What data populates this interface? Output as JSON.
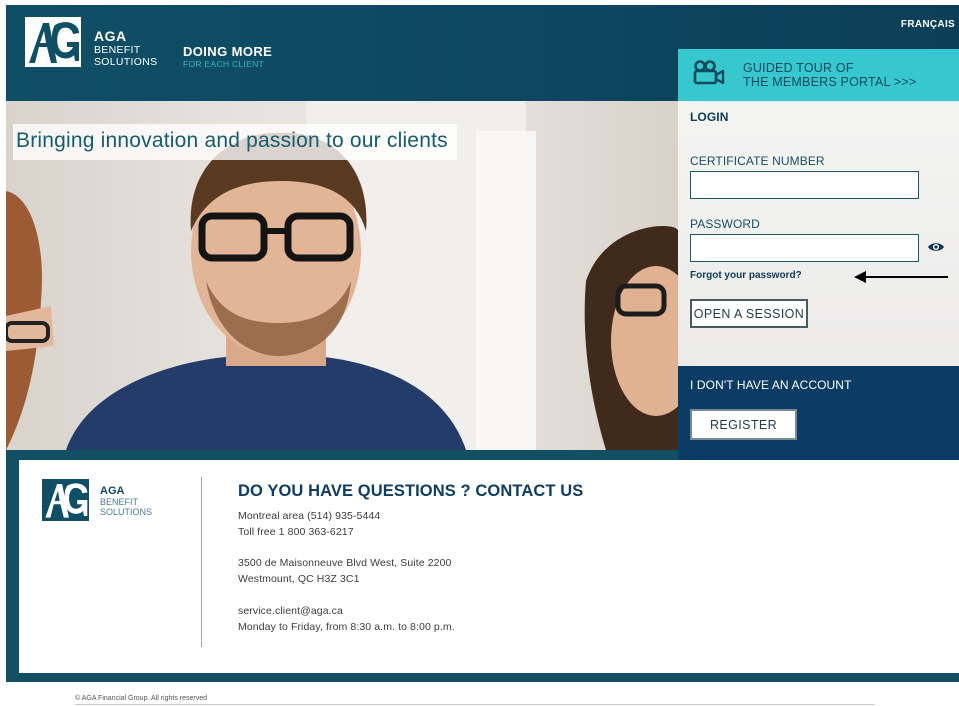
{
  "header": {
    "language_link": "FRANÇAIS",
    "brand": {
      "line1": "AGA",
      "line2": "BENEFIT",
      "line3": "SOLUTIONS"
    },
    "slogan": {
      "line1": "DOING MORE",
      "line2": "FOR EACH CLIENT"
    },
    "colors": {
      "header": "#0f4f66",
      "accent": "#3fb1c4"
    }
  },
  "tour": {
    "icon": "video-camera-icon",
    "line1": "GUIDED TOUR OF",
    "line2": "THE MEMBERS PORTAL >>>",
    "color": "#37c8cf"
  },
  "hero": {
    "caption": "Bringing innovation and passion to our clients"
  },
  "login": {
    "title": "LOGIN",
    "certificate_label": "CERTIFICATE NUMBER",
    "certificate_value": "",
    "password_label": "PASSWORD",
    "password_value": "",
    "show_password_icon": "eye-icon",
    "forgot_link": "Forgot your password?",
    "submit_label": "OPEN A SESSION"
  },
  "register": {
    "prompt": "I DON'T HAVE AN ACCOUNT",
    "button_label": "REGISTER",
    "color": "#0b3c66"
  },
  "contact": {
    "brand": {
      "line1": "AGA",
      "line2": "BENEFIT",
      "line3": "SOLUTIONS"
    },
    "title": "DO YOU HAVE QUESTIONS ? CONTACT US",
    "phone_local": "Montreal area (514) 935-5444",
    "phone_toll_free": "Toll free 1 800 363-6217",
    "address_line1": "3500 de Maisonneuve Blvd West, Suite 2200",
    "address_line2": "Westmount, QC H3Z 3C1",
    "email": "service.client@aga.ca",
    "hours": "Monday to Friday, from 8:30 a.m. to 8:00 p.m."
  },
  "footer": {
    "copyright": "© AGA Financial Group. All rights reserved"
  }
}
